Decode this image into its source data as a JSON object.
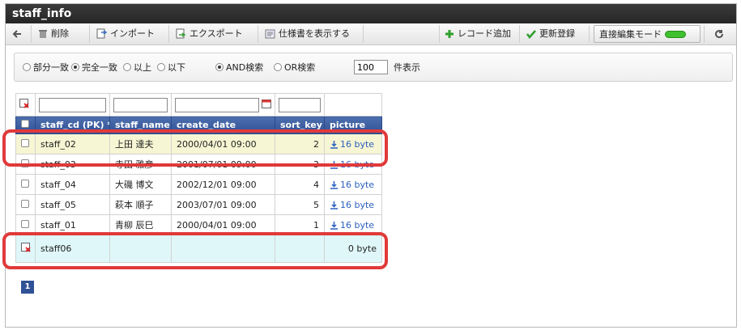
{
  "window": {
    "title": "staff_info"
  },
  "toolbar": {
    "delete": "削除",
    "import": "インポート",
    "export": "エクスポート",
    "spec": "仕様書を表示する",
    "add_record": "レコード追加",
    "update": "更新登録",
    "direct_edit": "直接編集モード"
  },
  "filters": {
    "partial": "部分一致",
    "exact": "完全一致",
    "gte": "以上",
    "lte": "以下",
    "and": "AND検索",
    "or": "OR検索",
    "count": "100",
    "count_suffix": "件表示"
  },
  "table": {
    "columns": [
      "staff_cd (PK) *",
      "staff_name",
      "create_date",
      "sort_key",
      "picture"
    ],
    "rows": [
      {
        "cd": "staff_02",
        "name": "上田 達夫",
        "date": "2000/04/01 09:00",
        "sort": "2",
        "pic": "16 byte"
      },
      {
        "cd": "staff_03",
        "name": "寺田 雅彦",
        "date": "2001/07/01 09:00",
        "sort": "3",
        "pic": "16 byte"
      },
      {
        "cd": "staff_04",
        "name": "大磯 博文",
        "date": "2002/12/01 09:00",
        "sort": "4",
        "pic": "16 byte"
      },
      {
        "cd": "staff_05",
        "name": "萩本 順子",
        "date": "2003/07/01 09:00",
        "sort": "5",
        "pic": "16 byte"
      },
      {
        "cd": "staff_01",
        "name": "青柳 辰巳",
        "date": "2000/04/01 09:00",
        "sort": "1",
        "pic": "16 byte"
      }
    ],
    "new_row": {
      "cd": "staff06",
      "pic": "0 byte"
    }
  },
  "pager": {
    "page": "1"
  },
  "colors": {
    "header": "#2f5296",
    "highlight": "#e03a3a",
    "selected": "#f6f6d4",
    "new": "#dff7f9"
  }
}
